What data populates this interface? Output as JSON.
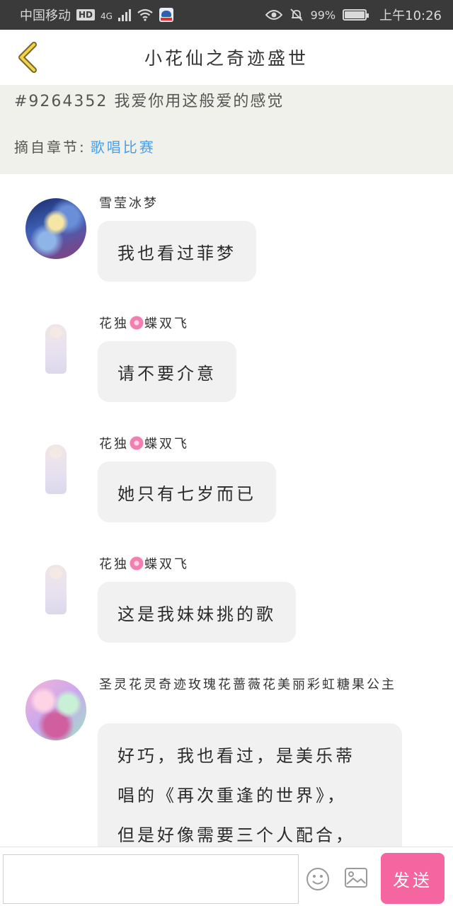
{
  "status_bar": {
    "carrier": "中国移动",
    "hd_badge": "HD",
    "network": "4G",
    "battery_level": "99%",
    "battery_fraction": 0.99,
    "time": "上午10:26"
  },
  "header": {
    "title": "小花仙之奇迹盛世"
  },
  "excerpt": {
    "quote": "#9264352 我爱你用这般爱的感觉",
    "chapter_label": "摘自章节:",
    "chapter_link": "歌唱比赛"
  },
  "messages": [
    {
      "user": "雪莹冰梦",
      "text": "我也看过菲梦"
    },
    {
      "user_pre": "花独",
      "user_post": "蝶双飞",
      "text": "请不要介意"
    },
    {
      "user_pre": "花独",
      "user_post": "蝶双飞",
      "text": "她只有七岁而已"
    },
    {
      "user_pre": "花独",
      "user_post": "蝶双飞",
      "text": "这是我妹妹挑的歌"
    },
    {
      "user": "圣灵花灵奇迹玫瑰花蔷薇花美丽彩虹糖果公主",
      "lines": [
        "好巧，我也看过，是美乐蒂",
        "唱的《再次重逢的世界》，",
        "但是好像需要三个人配合，"
      ]
    }
  ],
  "input_bar": {
    "placeholder": "",
    "send_label": "发送"
  },
  "colors": {
    "accent": "#f565a0",
    "link": "#4a9ee8",
    "excerpt_bg": "#f1f1ec",
    "bubble_bg": "#f1f1f1",
    "status_bg": "#3a3a3a"
  },
  "icons": [
    "back-chevron-icon",
    "eye-icon",
    "mute-bell-icon",
    "wifi-icon",
    "signal-icon",
    "battery-icon",
    "emoji-icon",
    "image-icon",
    "flower-icon"
  ]
}
